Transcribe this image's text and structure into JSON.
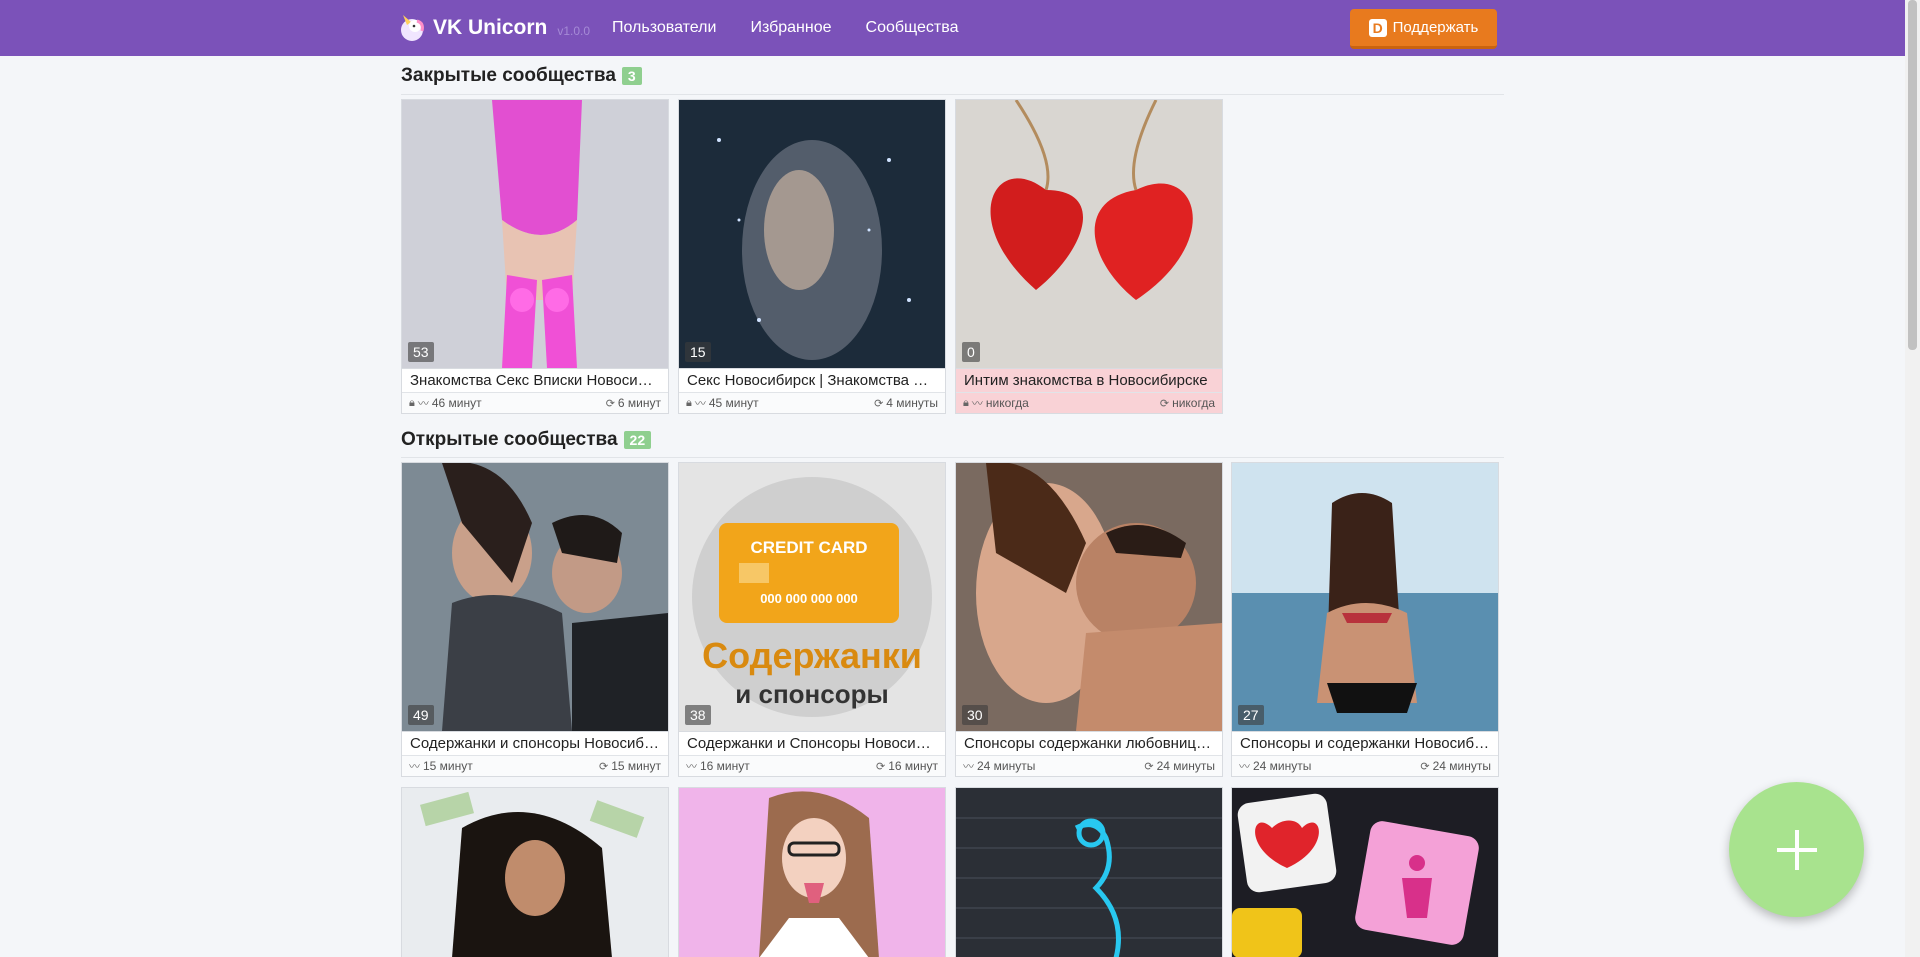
{
  "navbar": {
    "brand": "VK Unicorn",
    "version": "v1.0.0",
    "links": [
      "Пользователи",
      "Избранное",
      "Сообщества"
    ],
    "donate_label": "Поддержать",
    "donate_icon_letter": "D",
    "accent": "#7b52b9",
    "donate_color": "#e87a1e"
  },
  "sections": {
    "closed": {
      "title": "Закрытые сообщества",
      "count": "3",
      "cards": [
        {
          "count": "53",
          "title": "Знакомства Секс Вписки Новосибирск",
          "left": "46 минут",
          "right": "6 минут",
          "locked": true
        },
        {
          "count": "15",
          "title": "Секс Новосибирск | Знакомства Новосибирск",
          "left": "45 минут",
          "right": "4 минуты",
          "locked": true
        },
        {
          "count": "0",
          "title": "Интим знакомства в Новосибирске",
          "left": "никогда",
          "right": "никогда",
          "locked": true
        }
      ]
    },
    "open": {
      "title": "Открытые сообщества",
      "count": "22",
      "cards": [
        {
          "count": "49",
          "title": "Содержанки и спонсоры Новосибирск",
          "left": "15 минут",
          "right": "15 минут"
        },
        {
          "count": "38",
          "title": "Содержанки и Спонсоры Новосибирск",
          "left": "16 минут",
          "right": "16 минут",
          "img_title": "CREDIT CARD",
          "img_number": "000 000 000 000",
          "img_line1": "Содержанки",
          "img_line2": "и спонсоры"
        },
        {
          "count": "30",
          "title": "Спонсоры содержанки любовницы Новосибирск",
          "left": "24 минуты",
          "right": "24 минуты"
        },
        {
          "count": "27",
          "title": "Спонсоры и содержанки Новосибирск",
          "left": "24 минуты",
          "right": "24 минуты"
        }
      ]
    }
  },
  "icons": {
    "lock": "lock-icon",
    "activity": "activity-icon",
    "refresh": "refresh-icon",
    "add": "plus-icon"
  }
}
